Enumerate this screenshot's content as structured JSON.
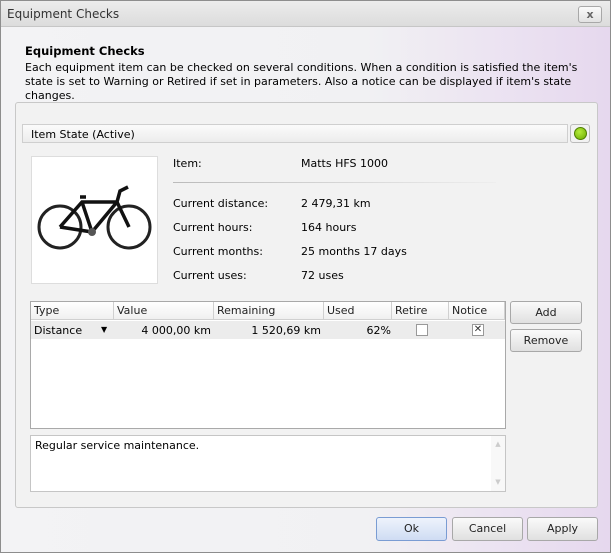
{
  "window": {
    "title": "Equipment Checks",
    "close_label": "x"
  },
  "header": {
    "title": "Equipment Checks",
    "description": "Each equipment item can be checked on several conditions. When a condition is satisfied the item's state is set to Warning or Retired if set in parameters. Also a notice can be displayed if item's state changes."
  },
  "state": {
    "label": "Item State (Active)",
    "indicator_color": "#7cc400"
  },
  "item": {
    "fields": [
      {
        "label": "Item:",
        "value": "Matts HFS 1000"
      },
      {
        "label": "Current distance:",
        "value": "2 479,31 km"
      },
      {
        "label": "Current hours:",
        "value": "164 hours"
      },
      {
        "label": "Current months:",
        "value": "25 months 17 days"
      },
      {
        "label": "Current uses:",
        "value": "72 uses"
      }
    ]
  },
  "grid": {
    "columns": [
      "Type",
      "Value",
      "Remaining",
      "Used",
      "Retire",
      "Notice"
    ],
    "rows": [
      {
        "type": "Distance",
        "value": "4 000,00 km",
        "remaining": "1 520,69 km",
        "used": "62%",
        "retire": false,
        "notice": true
      }
    ]
  },
  "side_buttons": {
    "add": "Add",
    "remove": "Remove"
  },
  "memo": {
    "text": "Regular service maintenance."
  },
  "footer": {
    "ok": "Ok",
    "cancel": "Cancel",
    "apply": "Apply"
  }
}
